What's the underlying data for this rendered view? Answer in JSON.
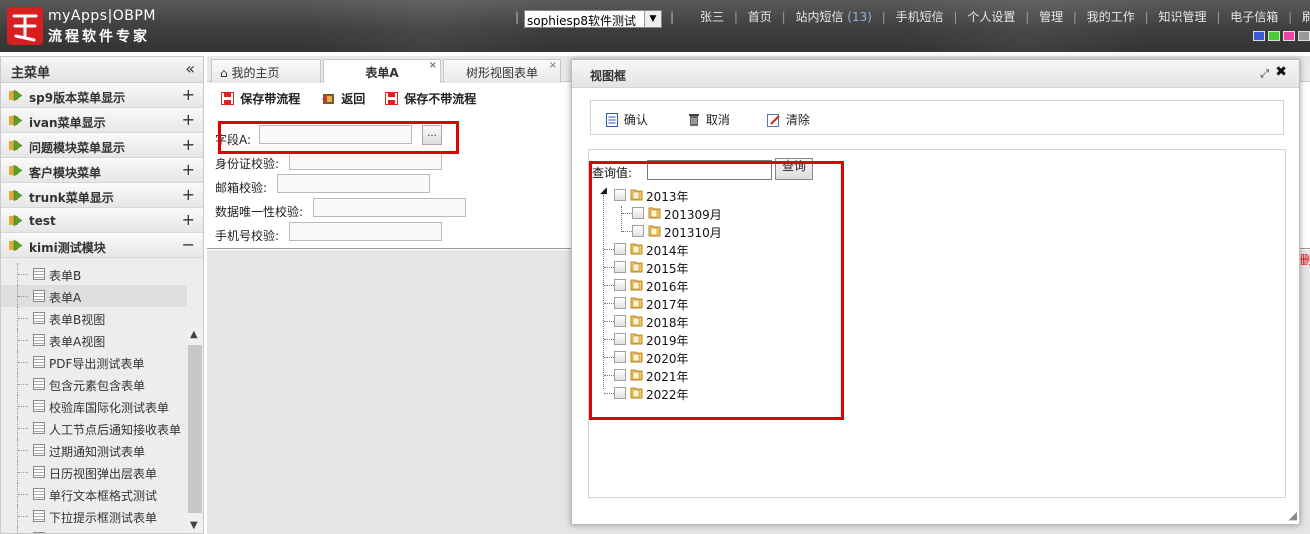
{
  "header": {
    "app_name": "myApps|OBPM",
    "app_slogan": "流程软件专家",
    "app_select": "sophiesp8软件测试",
    "user_name": "张三",
    "nav": [
      "首页",
      "站内短信",
      "手机短信",
      "个人设置",
      "管理",
      "我的工作",
      "知识管理",
      "电子信箱",
      "刷新"
    ],
    "msg_count": "(13)",
    "swatch_colors": [
      "#3b5bd6",
      "#44cc33",
      "#ee44aa",
      "#999999"
    ]
  },
  "sidebar": {
    "title": "主菜单",
    "collapse": "«",
    "groups": [
      {
        "label": "sp9版本菜单显示",
        "toggle": "+"
      },
      {
        "label": "ivan菜单显示",
        "toggle": "+"
      },
      {
        "label": "问题模块菜单显示",
        "toggle": "+"
      },
      {
        "label": "客户模块菜单",
        "toggle": "+"
      },
      {
        "label": "trunk菜单显示",
        "toggle": "+"
      },
      {
        "label": "test",
        "toggle": "+"
      },
      {
        "label": "kimi测试模块",
        "toggle": "−"
      }
    ],
    "items": [
      "表单B",
      "表单A",
      "表单B视图",
      "表单A视图",
      "PDF导出测试表单",
      "包含元素包含表单",
      "校验库国际化测试表单",
      "人工节点后通知接收表单",
      "过期通知测试表单",
      "日历视图弹出层表单",
      "单行文本框格式测试",
      "下拉提示框测试表单",
      "安卓客户端测试表单"
    ]
  },
  "tabs": [
    {
      "label": "我的主页",
      "icon": "home-icon"
    },
    {
      "label": "表单A",
      "close": "×"
    },
    {
      "label": "树形视图表单",
      "close": "×"
    }
  ],
  "toolbar": {
    "save_with_flow": "保存带流程",
    "back": "返回",
    "save_without_flow": "保存不带流程"
  },
  "form": {
    "field_a": "字段A:",
    "id_check": "身份证校验:",
    "email_check": "邮箱校验:",
    "unique_check": "数据唯一性校验:",
    "phone_check": "手机号校验:",
    "picker_button": "..."
  },
  "dialog": {
    "title": "视图框",
    "confirm": "确认",
    "cancel": "取消",
    "clear": "清除",
    "query_label": "查询值:",
    "query_button": "查询",
    "query_value": "",
    "tree": {
      "root": "2013年",
      "children": [
        "201309月",
        "201310月"
      ],
      "years": [
        "2014年",
        "2015年",
        "2016年",
        "2017年",
        "2018年",
        "2019年",
        "2020年",
        "2021年",
        "2022年"
      ]
    }
  },
  "edge_text": "删"
}
